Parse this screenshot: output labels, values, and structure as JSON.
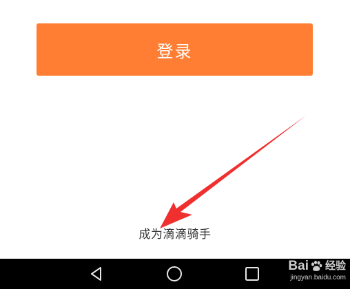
{
  "login_button": {
    "label": "登录"
  },
  "become_rider": {
    "label": "成为滴滴骑手"
  },
  "colors": {
    "accent": "#ff7e33",
    "annotation_arrow": "#f0302f",
    "nav_bar": "#000000"
  },
  "nav_bar": {
    "icons": [
      "back-icon",
      "home-icon",
      "recent-apps-icon"
    ]
  },
  "watermark": {
    "brand_left": "Bai",
    "brand_right": "经验",
    "url": "jingyan.baidu.com"
  }
}
